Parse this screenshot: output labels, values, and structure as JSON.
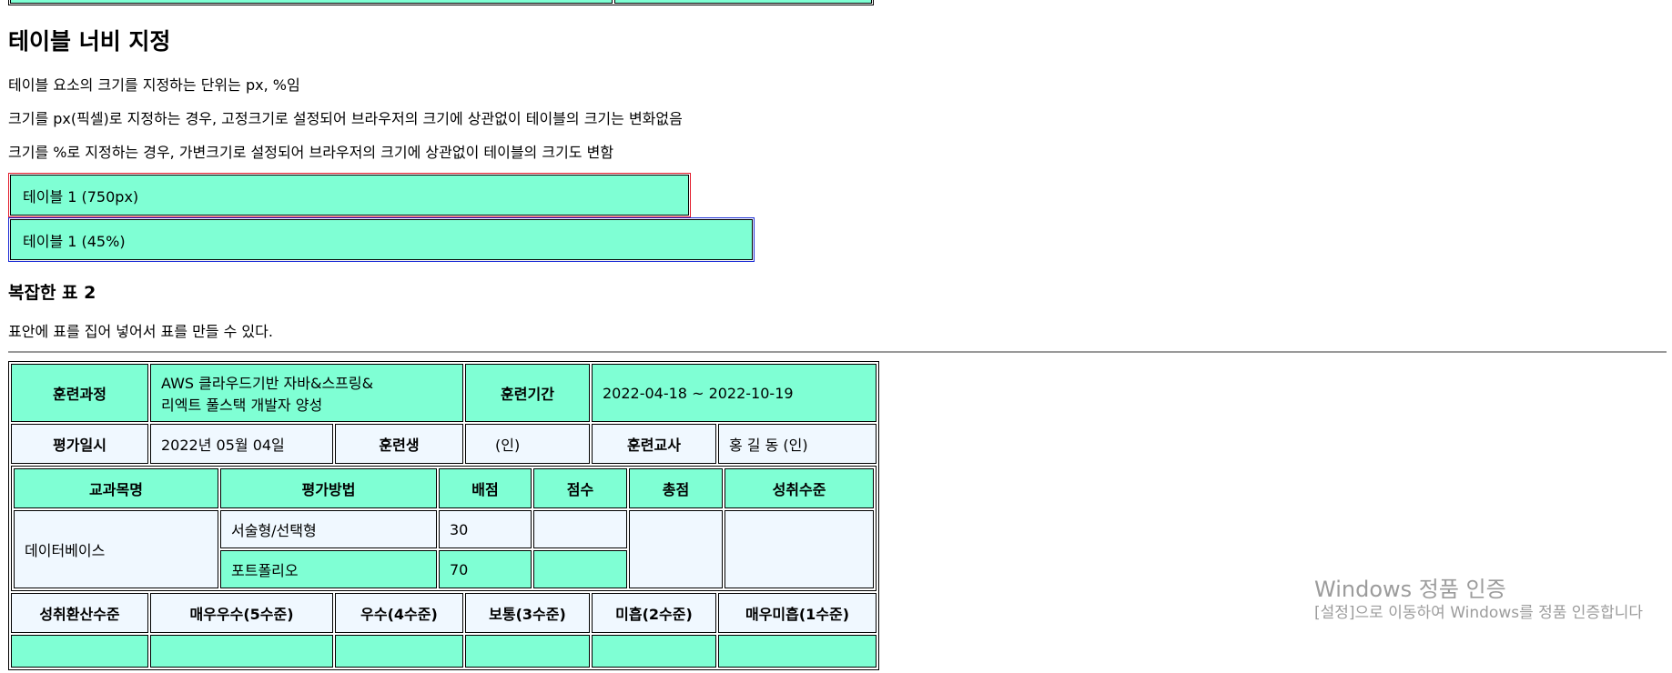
{
  "section": {
    "title": "테이블 너비 지정",
    "paragraphs": [
      "테이블 요소의 크기를 지정하는 단위는 px, %임",
      "크기를 px(픽셀)로 지정하는 경우, 고정크기로 설정되어 브라우저의 크기에 상관없이 테이블의 크기는 변화없음",
      "크기를 %로 지정하는 경우, 가변크기로 설정되어 브라우저의 크기에 상관없이 테이블의 크기도 변함"
    ],
    "table_px_label": "테이블 1 (750px)",
    "table_pct_label": "테이블 1 (45%)"
  },
  "complex": {
    "title": "복잡한 표 2",
    "desc": "표안에 표를 집어 넣어서 표를 만들 수 있다.",
    "row1": {
      "course_label": "훈련과정",
      "course_line1": "AWS 클라우드기반 자바&스프링&",
      "course_line2": "리엑트 풀스택 개발자 양성",
      "period_label": "훈련기간",
      "period_value": "2022-04-18 ~ 2022-10-19"
    },
    "row2": {
      "eval_date_label": "평가일시",
      "eval_date_value": "2022년 05월 04일",
      "trainee_label": "훈련생",
      "trainee_value": "(인)",
      "teacher_label": "훈련교사",
      "teacher_value": "홍 길 동 (인)"
    },
    "inner": {
      "headers": [
        "교과목명",
        "평가방법",
        "배점",
        "점수",
        "총점",
        "성취수준"
      ],
      "subject": "데이터베이스",
      "rows": [
        {
          "method": "서술형/선택형",
          "points": "30"
        },
        {
          "method": "포트폴리오",
          "points": "70"
        }
      ]
    },
    "levels": [
      "성취환산수준",
      "매우우수(5수준)",
      "우수(4수준)",
      "보통(3수준)",
      "미흡(2수준)",
      "매우미흡(1수준)"
    ]
  },
  "watermark": {
    "line1": "Windows 정품 인증",
    "line2": "[설정]으로 이동하여 Windows를 정품 인증합니다"
  },
  "colors": {
    "aquamarine": "#7fffd4",
    "aliceblue": "#f0f8ff",
    "red_border": "#e31b2b",
    "blue_border": "#1a2bd6"
  }
}
